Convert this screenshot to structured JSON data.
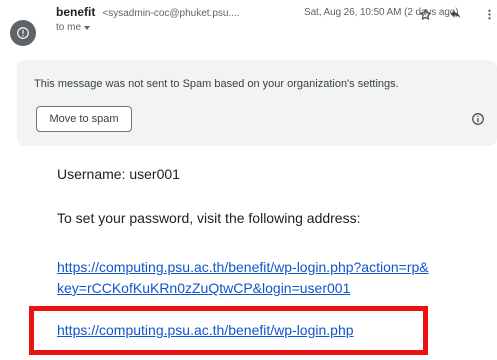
{
  "header": {
    "sender_name": "benefit",
    "sender_email": "<sysadmin-coc@phuket.psu....",
    "date": "Sat, Aug 26, 10:50 AM (2 days ago)",
    "recipient": "to me",
    "icons": [
      "star-icon",
      "reply-icon",
      "more-vert-icon"
    ]
  },
  "spam_banner": {
    "message": "This message was not sent to Spam based on your organization's settings.",
    "button_label": "Move to spam",
    "icon": "info-icon"
  },
  "email_body": {
    "username_line": "Username: user001",
    "instruction": "To set your password, visit the following address:",
    "reset_link_line1": "https://computing.psu.ac.th/benefit/wp-login.php?action=rp&",
    "reset_link_line2": "key=rCCKofKuKRn0zZuQtwCP&login=user001",
    "login_link": "https://computing.psu.ac.th/benefit/wp-login.php"
  },
  "colors": {
    "link": "#1155cc",
    "highlight_box": "#ee1111",
    "banner_bg": "#f1f3f4"
  }
}
